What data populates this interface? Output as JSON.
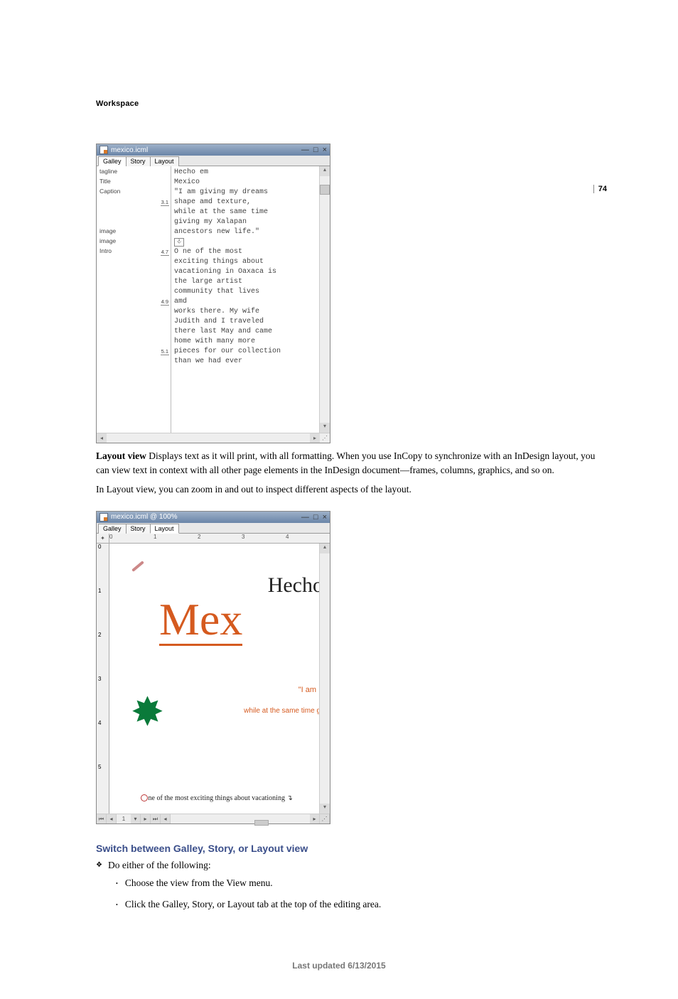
{
  "page": {
    "number": "74",
    "header": "Workspace",
    "footer": "Last updated 6/13/2015"
  },
  "galley_window": {
    "title": "mexico.icml",
    "tabs": [
      "Galley",
      "Story",
      "Layout"
    ],
    "active_tab": "Galley",
    "left_labels": [
      {
        "name": "tagline"
      },
      {
        "name": "Title"
      },
      {
        "name": "Caption"
      },
      {
        "name": "",
        "depth": "3.1"
      },
      {
        "name": ""
      },
      {
        "name": ""
      },
      {
        "name": "image"
      },
      {
        "name": "image"
      },
      {
        "name": "Intro",
        "depth": "4.7"
      },
      {
        "name": ""
      },
      {
        "name": ""
      },
      {
        "name": ""
      },
      {
        "name": ""
      },
      {
        "name": "",
        "depth": "4.9"
      },
      {
        "name": ""
      },
      {
        "name": ""
      },
      {
        "name": ""
      },
      {
        "name": ""
      },
      {
        "name": "",
        "depth": "5.1"
      }
    ],
    "text_lines": [
      "Hecho em",
      "Mexico",
      "\"I am giving my dreams",
      "shape amd texture,",
      "while at the same time",
      "giving my Xalapan",
      "ancestors new life.\"",
      "[anchor]",
      "O     ne of the most",
      "exciting things about",
      "vacationing in Oaxaca is",
      "the large artist",
      "community that lives",
      "                     amd",
      "works there. My wife",
      "Judith and I traveled",
      "there last May and came",
      "home with many more",
      "pieces for our collection",
      "than we had ever"
    ]
  },
  "para_layout": {
    "lead": "Layout view",
    "text": "  Displays text as it will print, with all formatting. When you use InCopy to synchronize with an InDesign layout, you can view text in context with all other page elements in the InDesign document—frames, columns, graphics, and so on."
  },
  "para_zoom": "In Layout view, you can zoom in and out to inspect different aspects of the layout.",
  "layout_window": {
    "title": "mexico.icml @ 100%",
    "tabs": [
      "Galley",
      "Story",
      "Layout"
    ],
    "active_tab": "Layout",
    "ruler_marks": [
      "0",
      "1",
      "2",
      "3",
      "4"
    ],
    "vruler_marks": [
      "0",
      "1",
      "2",
      "3",
      "4",
      "5"
    ],
    "hecho": "Hecho",
    "mex": "Mex",
    "iam": "\"I am",
    "while": "while at the same time g",
    "intro": "ne of the most exciting things about vacationing",
    "page_num": "1"
  },
  "section": {
    "heading": "Switch between Galley, Story, or Layout view",
    "lead": "Do either of the following:",
    "items": [
      "Choose the view from the View menu.",
      "Click the Galley, Story, or Layout tab at the top of the editing area."
    ]
  }
}
